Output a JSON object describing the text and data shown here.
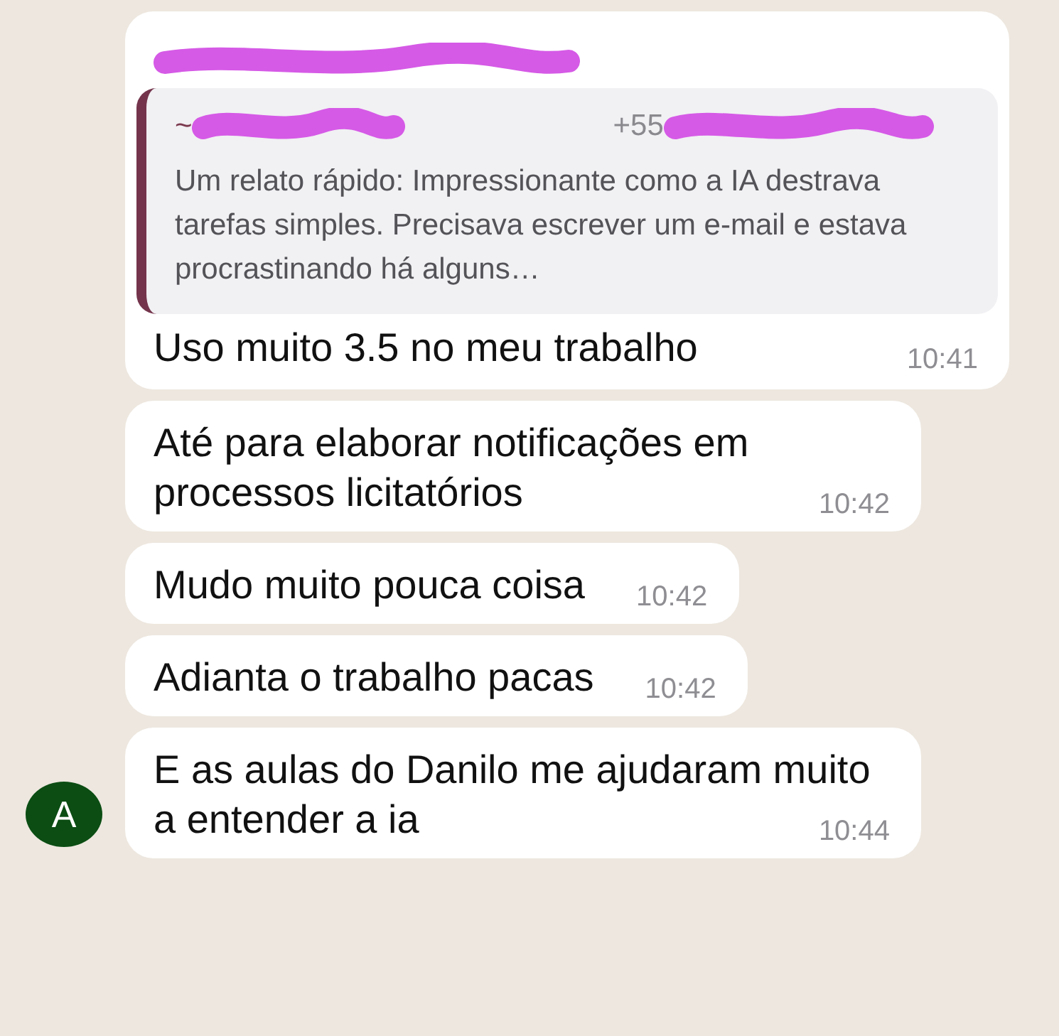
{
  "messages": [
    {
      "kind": "quoted",
      "quote": {
        "prefix": "~",
        "phone_prefix": "+55",
        "text": "Um relato rápido: Impressionante como a IA destrava tarefas simples. Precisava escrever um e-mail e estava procrastinando há alguns…"
      },
      "text": "Uso muito 3.5 no meu trabalho",
      "time": "10:41"
    },
    {
      "kind": "plain",
      "text": "Até para elaborar notificações em processos licitatórios",
      "time": "10:42"
    },
    {
      "kind": "plain",
      "text": "Mudo muito pouca coisa",
      "time": "10:42"
    },
    {
      "kind": "plain",
      "text": "Adianta o trabalho pacas",
      "time": "10:42"
    },
    {
      "kind": "plain",
      "text": "E as aulas do Danilo me ajudaram muito a entender a ia",
      "time": "10:44"
    }
  ],
  "avatar": {
    "initial": "A"
  }
}
